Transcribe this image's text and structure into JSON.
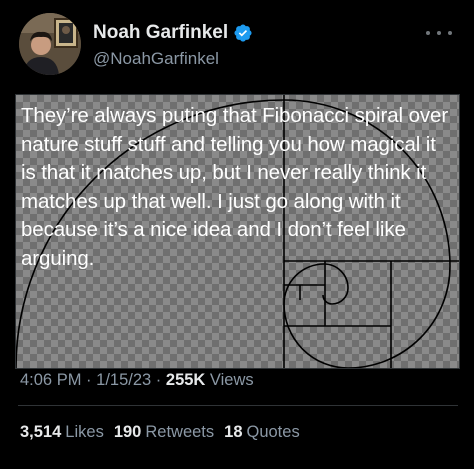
{
  "author": {
    "display_name": "Noah Garfinkel",
    "handle": "@NoahGarfinkel",
    "verified": true,
    "avatar_icon": "person-with-framed-portrait-avatar"
  },
  "media": {
    "text": "They’re always puting that Fibonacci spiral over nature stuff stuff and telling you how magical it is that it matches up, but I never really think it matches up that well. I just go along with it because it’s a nice idea and I don’t feel like arguing."
  },
  "meta": {
    "time": "4:06 PM",
    "date": "1/15/23",
    "views_count": "255K",
    "views_label": "Views",
    "separator": "·"
  },
  "stats": {
    "likes_count": "3,514",
    "likes_label": "Likes",
    "retweets_count": "190",
    "retweets_label": "Retweets",
    "quotes_count": "18",
    "quotes_label": "Quotes"
  },
  "colors": {
    "background": "#000000",
    "primary_text": "#e7e9ea",
    "secondary_text": "#8b98a5",
    "verified_blue": "#1d9bf0",
    "divider": "#2f3336"
  }
}
